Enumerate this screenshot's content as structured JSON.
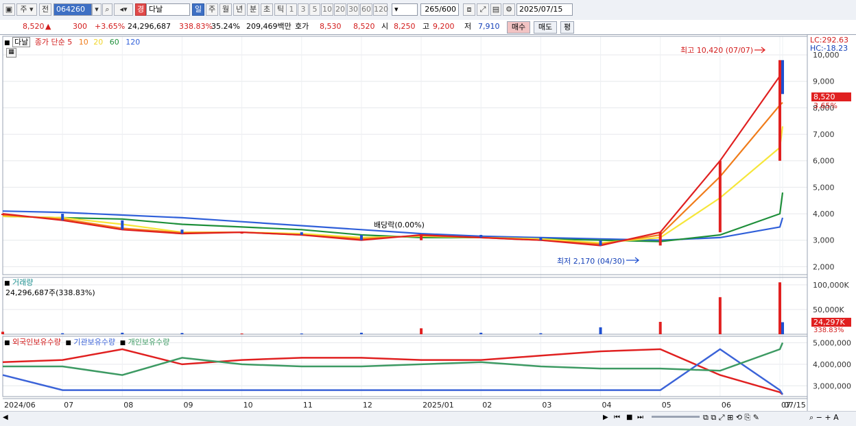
{
  "toolbar": {
    "market": "주",
    "mode": "전",
    "code": "064260",
    "grade": "경",
    "name": "다날",
    "periods": [
      "일",
      "주",
      "월",
      "년",
      "분",
      "초",
      "틱"
    ],
    "active_period": "일",
    "intervals": [
      "1",
      "3",
      "5",
      "10",
      "20",
      "30",
      "60",
      "120"
    ],
    "count": "265",
    "count_max": "/600",
    "date": "2025/07/15"
  },
  "quote": {
    "price": "8,520",
    "up_icon": "▲",
    "change": "300",
    "change_pct": "+3.65%",
    "volume": "24,296,687",
    "volume_ratio": "338.83%",
    "turnover": "35.24%",
    "amount": "209,469백만",
    "ask_label": "호가",
    "ask": "8,530",
    "bid": "8,520",
    "open_label": "시",
    "open": "8,250",
    "high_label": "고",
    "high": "9,200",
    "low_label": "저",
    "low": "7,910",
    "buy_label": "매수",
    "sell_label": "매도",
    "eval_label": "평"
  },
  "price_panel": {
    "stock_tag": "다날",
    "legend_prefix": "종가 단순",
    "ma_labels": [
      "5",
      "10",
      "20",
      "60",
      "120"
    ],
    "lc": "LC:292.63",
    "hc": "HC:-18.23",
    "last_price": "8,520",
    "last_pct": "3.65%",
    "high_note": "최고 10,420 (07/07)",
    "low_note": "최저 2,170 (04/30)",
    "dividend_note": "배당락(0.00%)"
  },
  "volume_panel": {
    "title": "거래량",
    "value": "24,296,687주(338.83%)",
    "last": "24,297K",
    "last_pct": "338.83%"
  },
  "holding_panel": {
    "foreign": "외국인보유수량",
    "institution": "기관보유수량",
    "individual": "개인보유수량"
  },
  "right_axis_labels": {
    "y_price": [
      "10,000",
      "9,000",
      "8,000",
      "7,000",
      "6,000",
      "5,000",
      "4,000",
      "3,000",
      "2,000"
    ],
    "y_volume": [
      "100,000K",
      "50,000K"
    ],
    "y_holding": [
      "5,000,000",
      "4,000,000",
      "3,000,000"
    ]
  },
  "x_axis_labels": [
    "2024/06",
    "07",
    "08",
    "09",
    "10",
    "11",
    "12",
    "2025/01",
    "02",
    "03",
    "04",
    "05",
    "06",
    "07",
    "07/15"
  ],
  "colors": {
    "up": "#e12020",
    "down": "#1f4fd0",
    "ma5": "#e02020",
    "ma10": "#f07c1a",
    "ma20": "#f6e63a",
    "ma60": "#1e8f3a",
    "ma120": "#2f5fd9",
    "foreign": "#e02020",
    "institution": "#3b63d8",
    "individual": "#3d9a63"
  },
  "chart_data": [
    {
      "type": "line",
      "name": "price",
      "x": [
        "2024/06",
        "2024/07",
        "2024/08",
        "2024/09",
        "2024/10",
        "2024/11",
        "2024/12",
        "2025/01",
        "2025/02",
        "2025/03",
        "2025/04",
        "2025/05",
        "2025/06",
        "2025/07",
        "2025/07/15"
      ],
      "close": [
        4000,
        3750,
        3400,
        3250,
        3300,
        3200,
        3000,
        3200,
        3100,
        3000,
        2800,
        3300,
        6000,
        9800,
        8520
      ],
      "ma": {
        "5": [
          4000,
          3750,
          3400,
          3250,
          3300,
          3200,
          3000,
          3200,
          3100,
          3000,
          2800,
          3300,
          6000,
          9200,
          8700
        ],
        "10": [
          3950,
          3800,
          3450,
          3280,
          3300,
          3200,
          3050,
          3180,
          3100,
          3000,
          2850,
          3200,
          5400,
          8100,
          8200
        ],
        "20": [
          3900,
          3850,
          3600,
          3300,
          3300,
          3250,
          3100,
          3150,
          3100,
          3050,
          2900,
          3100,
          4600,
          6500,
          7300
        ],
        "60": [
          3900,
          3850,
          3800,
          3600,
          3500,
          3400,
          3200,
          3100,
          3100,
          3050,
          3000,
          2950,
          3200,
          4000,
          4800
        ],
        "120": [
          4100,
          4050,
          3950,
          3850,
          3700,
          3550,
          3400,
          3250,
          3150,
          3100,
          3050,
          3000,
          3100,
          3500,
          3850
        ]
      },
      "ylim": [
        1700,
        10700
      ]
    },
    {
      "type": "bar",
      "name": "volume",
      "x": [
        "2024/06",
        "2024/07",
        "2024/08",
        "2024/09",
        "2024/10",
        "2024/11",
        "2024/12",
        "2025/01",
        "2025/02",
        "2025/03",
        "2025/04",
        "2025/05",
        "2025/06",
        "2025/07",
        "2025/07/15"
      ],
      "values_k": [
        5000,
        2000,
        3000,
        2500,
        1500,
        1500,
        3000,
        12000,
        3000,
        2000,
        14000,
        25000,
        75000,
        105000,
        24297
      ],
      "ylim": [
        0,
        115000
      ]
    },
    {
      "type": "line",
      "name": "holdings",
      "x": [
        "2024/06",
        "2024/07",
        "2024/08",
        "2024/09",
        "2024/10",
        "2024/11",
        "2024/12",
        "2025/01",
        "2025/02",
        "2025/03",
        "2025/04",
        "2025/05",
        "2025/06",
        "2025/07",
        "2025/07/15"
      ],
      "series": [
        {
          "name": "외국인보유수량",
          "values": [
            4100,
            4200,
            4700,
            4000,
            4200,
            4300,
            4300,
            4200,
            4200,
            4400,
            4600,
            4700,
            3500,
            2700,
            2600
          ]
        },
        {
          "name": "기관보유수량",
          "values": [
            3500,
            2800,
            2800,
            2800,
            2800,
            2800,
            2800,
            2800,
            2800,
            2800,
            2800,
            2800,
            4700,
            2800,
            2600
          ]
        },
        {
          "name": "개인보유수량",
          "values": [
            3900,
            3900,
            3500,
            4300,
            4000,
            3900,
            3900,
            4000,
            4100,
            3900,
            3800,
            3800,
            3700,
            4700,
            5000
          ]
        }
      ],
      "unit": "thousand shares",
      "ylim": [
        2500,
        5300
      ]
    }
  ]
}
